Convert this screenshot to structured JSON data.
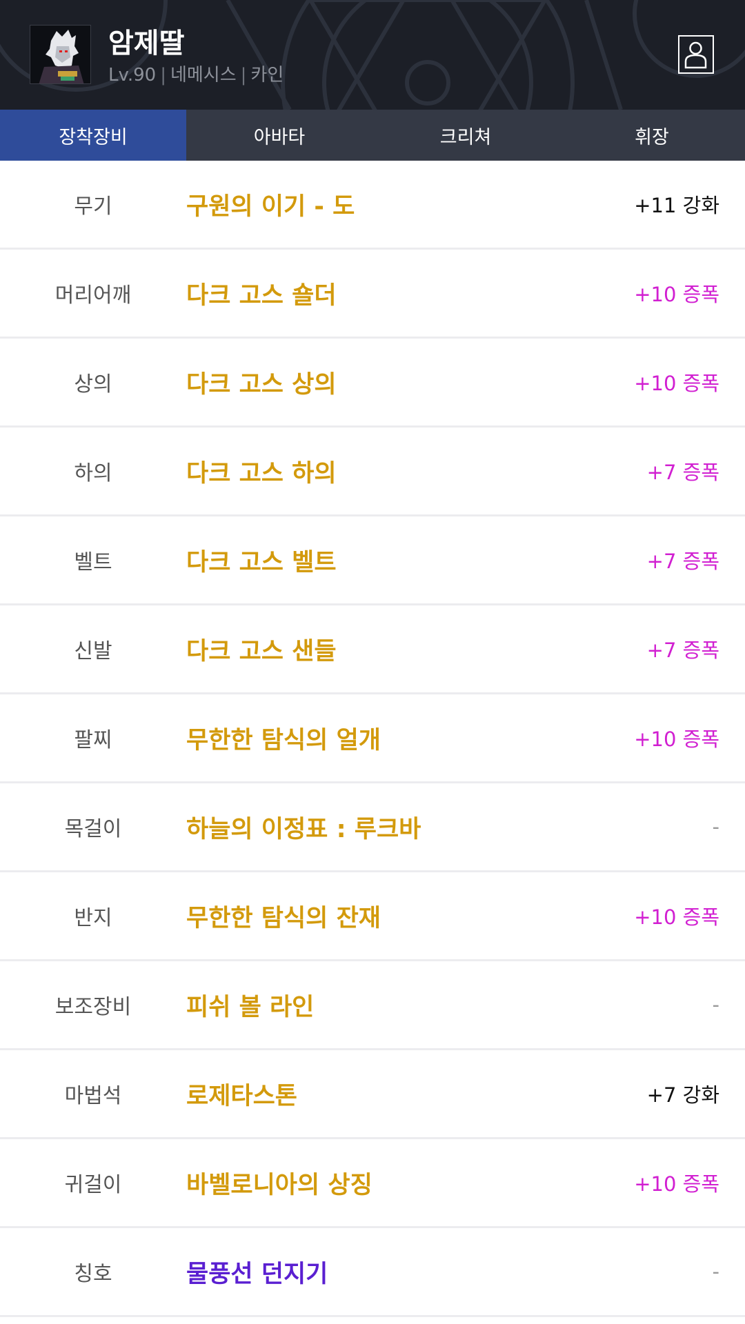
{
  "header": {
    "character_name": "암제딸",
    "level": "Lv.90",
    "job": "네메시스",
    "server": "카인",
    "separator": "|",
    "profile_icon": "person-icon"
  },
  "tabs": [
    {
      "label": "장착장비",
      "active": true
    },
    {
      "label": "아바타",
      "active": false
    },
    {
      "label": "크리쳐",
      "active": false
    },
    {
      "label": "휘장",
      "active": false
    }
  ],
  "colors": {
    "header_bg": "#1c1f27",
    "tab_bar_bg": "#343945",
    "tab_active_bg": "#2f4c9a",
    "item_name": "#d39a0c",
    "title_item_name": "#5a1fd1",
    "amplify_text": "#d11fd1",
    "enhance_text": "#111111"
  },
  "equipment": [
    {
      "slot": "무기",
      "item": "구원의 이기 - 도",
      "status": "+11 강화",
      "type": "enhance",
      "rarity": "epic"
    },
    {
      "slot": "머리어깨",
      "item": "다크 고스 숄더",
      "status": "+10 증폭",
      "type": "amplify",
      "rarity": "epic"
    },
    {
      "slot": "상의",
      "item": "다크 고스 상의",
      "status": "+10 증폭",
      "type": "amplify",
      "rarity": "epic"
    },
    {
      "slot": "하의",
      "item": "다크 고스 하의",
      "status": "+7 증폭",
      "type": "amplify",
      "rarity": "epic"
    },
    {
      "slot": "벨트",
      "item": "다크 고스 벨트",
      "status": "+7 증폭",
      "type": "amplify",
      "rarity": "epic"
    },
    {
      "slot": "신발",
      "item": "다크 고스 샌들",
      "status": "+7 증폭",
      "type": "amplify",
      "rarity": "epic"
    },
    {
      "slot": "팔찌",
      "item": "무한한 탐식의 얼개",
      "status": "+10 증폭",
      "type": "amplify",
      "rarity": "epic"
    },
    {
      "slot": "목걸이",
      "item": "하늘의 이정표 : 루크바",
      "status": "-",
      "type": "none",
      "rarity": "epic"
    },
    {
      "slot": "반지",
      "item": "무한한 탐식의 잔재",
      "status": "+10 증폭",
      "type": "amplify",
      "rarity": "epic"
    },
    {
      "slot": "보조장비",
      "item": "피쉬 볼 라인",
      "status": "-",
      "type": "none",
      "rarity": "epic"
    },
    {
      "slot": "마법석",
      "item": "로제타스톤",
      "status": "+7 강화",
      "type": "enhance",
      "rarity": "epic"
    },
    {
      "slot": "귀걸이",
      "item": "바벨로니아의 상징",
      "status": "+10 증폭",
      "type": "amplify",
      "rarity": "epic"
    },
    {
      "slot": "칭호",
      "item": "물풍선 던지기",
      "status": "-",
      "type": "none",
      "rarity": "unique"
    }
  ]
}
